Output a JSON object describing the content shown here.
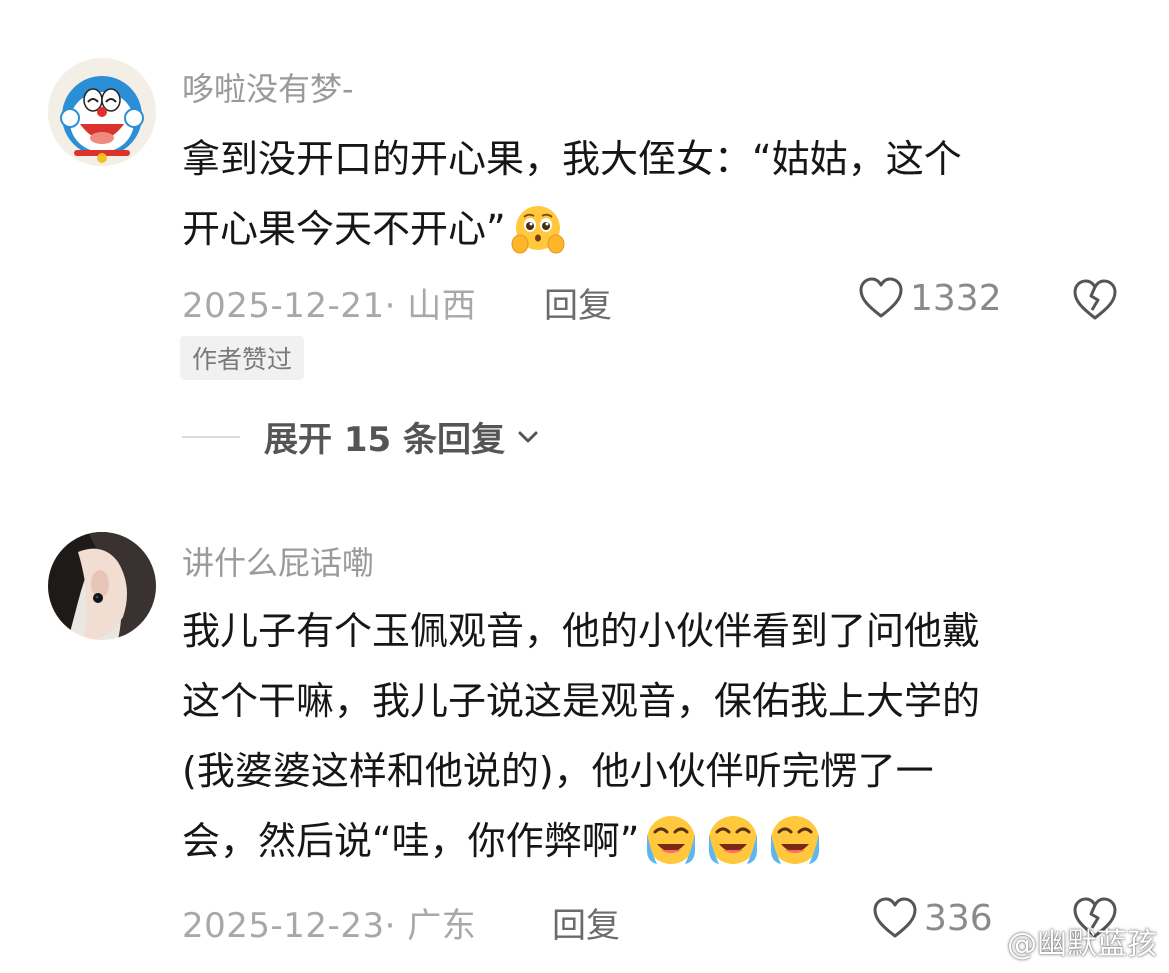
{
  "comments": [
    {
      "username": "哆啦没有梦-",
      "avatar_icon": "doraemon-avatar",
      "content_lines": [
        "拿到没开口的开心果，我大侄女：“姑姑，这个",
        "开心果今天不开心”"
      ],
      "emojis": [
        "pleading-face-icon"
      ],
      "timestamp": "2025-12-21· 山西",
      "reply_label": "回复",
      "like_count": "1332",
      "badge": "作者赞过",
      "expand_label": "展开 15 条回复"
    },
    {
      "username": "讲什么屁话嘞",
      "avatar_icon": "girl-profile-avatar",
      "content_lines": [
        "我儿子有个玉佩观音，他的小伙伴看到了问他戴",
        "这个干嘛，我儿子说这是观音，保佑我上大学的",
        "(我婆婆这样和他说的)，他小伙伴听完愣了一",
        "会，然后说“哇，你作弊啊”"
      ],
      "emojis": [
        "crying-face-icon",
        "crying-face-icon",
        "crying-face-icon"
      ],
      "timestamp": "2025-12-23· 广东",
      "reply_label": "回复",
      "like_count": "336"
    }
  ],
  "watermark": {
    "text": "@幽默蓝孩",
    "icon": "weibo-logo-icon"
  },
  "colors": {
    "username": "#9a9a9a",
    "content": "#161616",
    "meta": "#a8a8a8",
    "badge_bg": "#f1f1f1"
  }
}
